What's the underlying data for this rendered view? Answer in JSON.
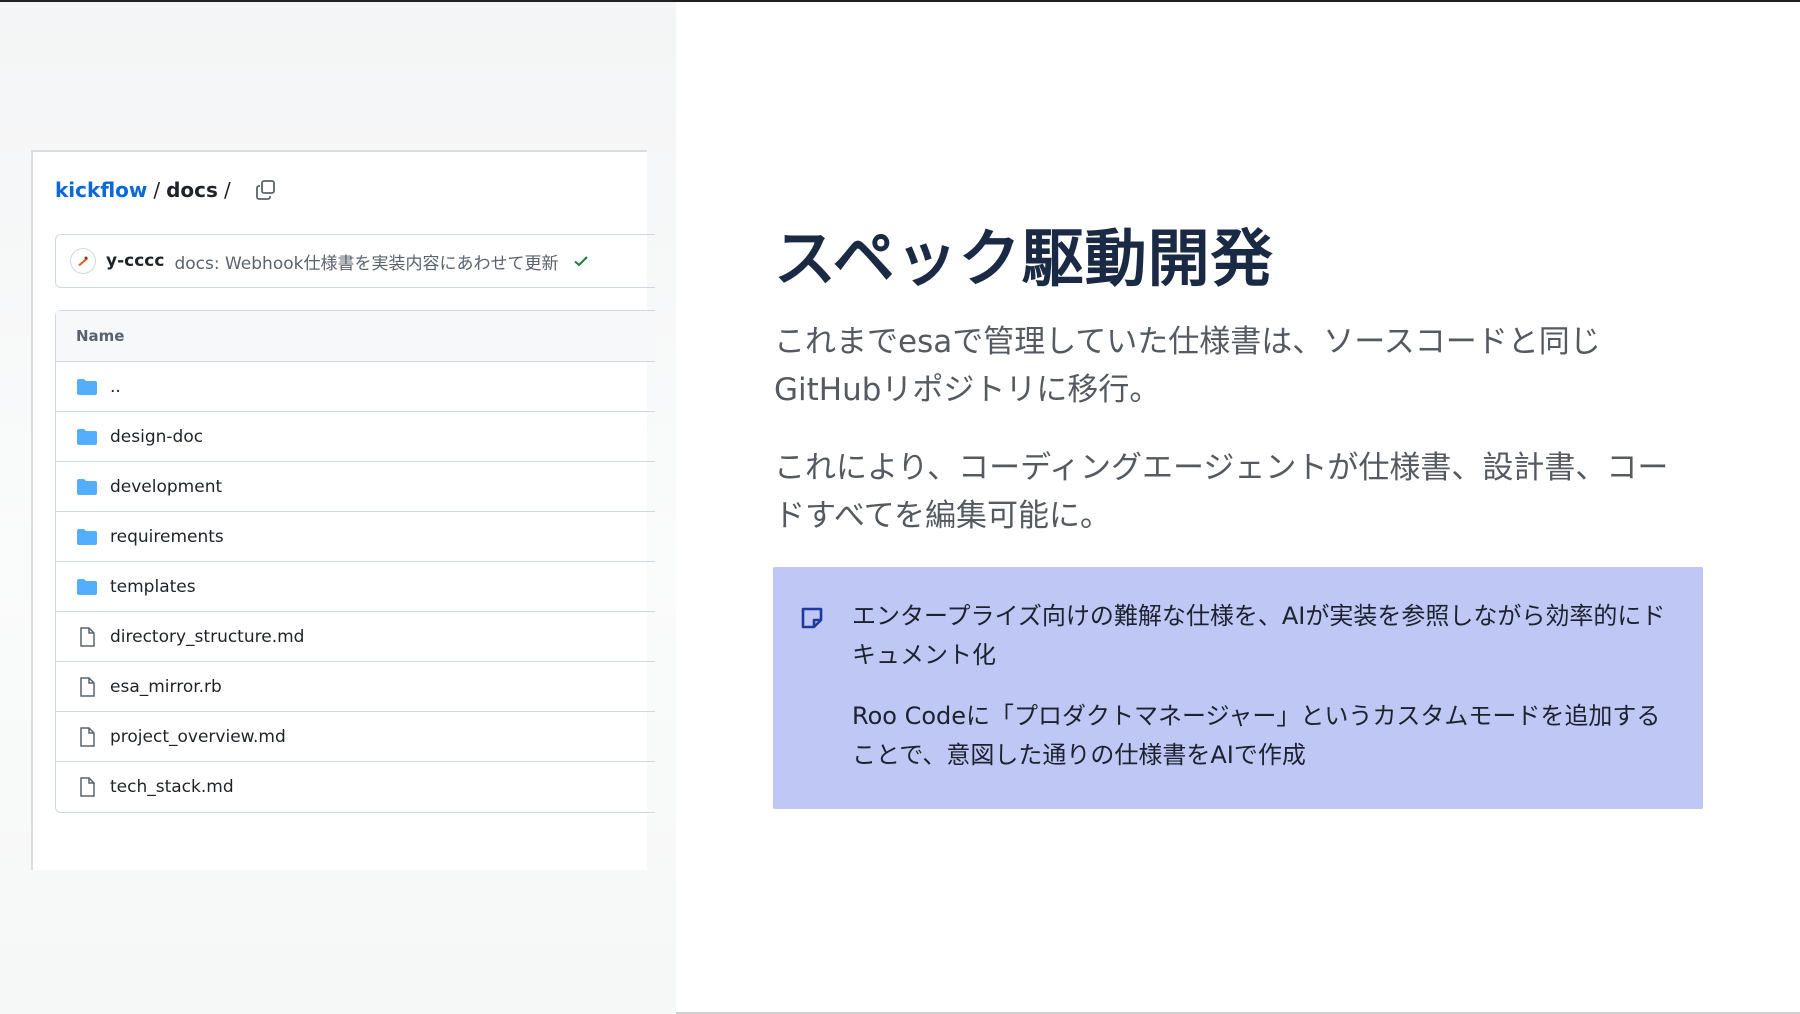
{
  "repo_screenshot": {
    "breadcrumb": {
      "repo": "kickflow",
      "sep1": "/",
      "folder": "docs",
      "sep2": "/"
    },
    "commit": {
      "author": "y-cccc",
      "message": "docs: Webhook仕様書を実装内容にあわせて更新",
      "status": "success"
    },
    "table": {
      "header": "Name",
      "rows": [
        {
          "name": "..",
          "type": "folder"
        },
        {
          "name": "design-doc",
          "type": "folder"
        },
        {
          "name": "development",
          "type": "folder"
        },
        {
          "name": "requirements",
          "type": "folder"
        },
        {
          "name": "templates",
          "type": "folder"
        },
        {
          "name": "directory_structure.md",
          "type": "file"
        },
        {
          "name": "esa_mirror.rb",
          "type": "file"
        },
        {
          "name": "project_overview.md",
          "type": "file"
        },
        {
          "name": "tech_stack.md",
          "type": "file"
        }
      ]
    }
  },
  "slide": {
    "title": "スペック駆動開発",
    "paragraph1": "これまでesaで管理していた仕様書は、ソースコードと同じGitHubリポジトリに移行。",
    "paragraph2": "これにより、コーディングエージェントが仕様書、設計書、コードすべてを編集可能に。",
    "callout": {
      "icon": "note-icon",
      "text1": "エンタープライズ向けの難解な仕様を、AIが実装を参照しながら効率的にドキュメント化",
      "text2": "Roo Codeに「プロダクトマネージャー」というカスタムモードを追加することで、意図した通りの仕様書をAIで作成"
    }
  },
  "colors": {
    "title": "#1b2a44",
    "body_text": "#555a61",
    "callout_bg": "#bfc8f4",
    "link": "#0969da",
    "folder": "#54aeff",
    "check": "#1a7f37"
  }
}
